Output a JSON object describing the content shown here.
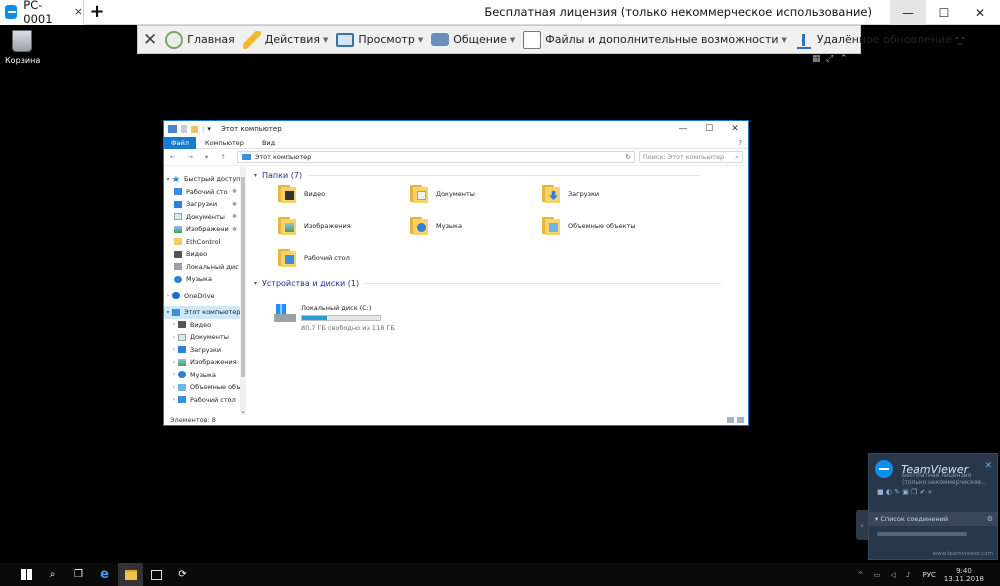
{
  "window": {
    "tab_label": "PC-0001",
    "tab_close": "×",
    "new_tab": "+",
    "license": "Бесплатная лицензия (только некоммерческое использование)",
    "min": "—",
    "max": "☐",
    "close": "✕"
  },
  "toolbar": {
    "close": "✕",
    "items": [
      {
        "label": "Главная"
      },
      {
        "label": "Действия"
      },
      {
        "label": "Просмотр"
      },
      {
        "label": "Общение"
      },
      {
        "label": "Файлы и дополнительные возможности"
      },
      {
        "label": "Удалённое обновление"
      }
    ],
    "arrow": "▼"
  },
  "desktop": {
    "recycle_label": "Корзина"
  },
  "explorer": {
    "title": "Этот компьютер",
    "qa_sep": "|",
    "qa_arrow": "▾",
    "ctrl_min": "—",
    "ctrl_max": "☐",
    "ctrl_close": "✕",
    "ribbon": {
      "file": "Файл",
      "computer": "Компьютер",
      "view": "Вид",
      "help": "?"
    },
    "nav_buttons": "← → ▾ ↑",
    "address": "Этот компьютер",
    "refresh": "↻",
    "search_placeholder": "Поиск: Этот компьютер",
    "search_icon": "⌕",
    "nav_items": [
      {
        "label": "Быстрый доступ",
        "chev": "▾"
      },
      {
        "label": "Рабочий сто",
        "pin": "✱"
      },
      {
        "label": "Загрузки",
        "pin": "✱"
      },
      {
        "label": "Документы",
        "pin": "✱"
      },
      {
        "label": "Изображени",
        "pin": "✱"
      },
      {
        "label": "EthControl"
      },
      {
        "label": "Видео"
      },
      {
        "label": "Локальный дис"
      },
      {
        "label": "Музыка"
      },
      {
        "label": "OneDrive",
        "chev": "›"
      },
      {
        "label": "Этот компьютер",
        "chev": "▾"
      },
      {
        "label": "Видео",
        "chev": "›"
      },
      {
        "label": "Документы",
        "chev": "›"
      },
      {
        "label": "Загрузки",
        "chev": "›"
      },
      {
        "label": "Изображения",
        "chev": "›"
      },
      {
        "label": "Музыка",
        "chev": "›"
      },
      {
        "label": "Объемные объ",
        "chev": "›"
      },
      {
        "label": "Рабочий стол",
        "chev": "›"
      }
    ],
    "scroll_arrow": "⌄",
    "group_folders": "Папки (7)",
    "group_devices": "Устройства и диски (1)",
    "group_chevron": "▾",
    "folders": [
      {
        "label": "Видео"
      },
      {
        "label": "Документы"
      },
      {
        "label": "Загрузки"
      },
      {
        "label": "Изображения"
      },
      {
        "label": "Музыка"
      },
      {
        "label": "Объемные объекты"
      },
      {
        "label": "Рабочий стол"
      }
    ],
    "drive": {
      "label": "Локальный диск (C:)",
      "free": "80,7 ГБ свободно из 118 ГБ",
      "used_fraction": 0.32
    },
    "status": "Элементов: 8"
  },
  "tvpanel": {
    "brand": "TeamViewer",
    "sub": "Бесплатная лицензия (только некоммерческое...",
    "close": "✕",
    "icons": "■ ◐ ✎ ▣ ❐ ✔ «",
    "list_title": "▾ Список соединений",
    "gear": "⚙",
    "url": "www.teamviewer.com",
    "handle": "›"
  },
  "taskbar": {
    "search": "⌕",
    "taskview": "❐",
    "edge": "e",
    "tv": "⟳",
    "tray_icons": "^ ▭ ◁ ♪",
    "lang": "РУС",
    "time": "9:40",
    "date": "13.11.2018"
  }
}
